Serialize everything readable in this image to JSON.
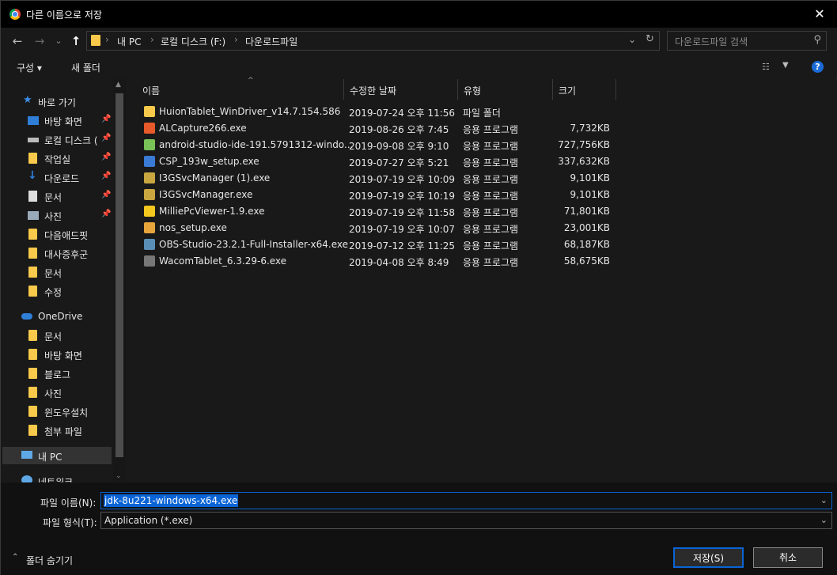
{
  "window": {
    "title": "다른 이름으로 저장",
    "close": "✕"
  },
  "nav": {
    "back": "←",
    "forward": "→",
    "history": "⌄",
    "up": "↑",
    "breadcrumb": [
      "내 PC",
      "로컬 디스크 (F:)",
      "다운로드파일"
    ],
    "search_placeholder": "다운로드파일 검색"
  },
  "toolbar": {
    "organize": "구성 ▾",
    "new_folder": "새 폴더"
  },
  "sidebar": {
    "quick_access": "바로 가기",
    "items": [
      {
        "label": "바탕 화면",
        "icon": "desktop-icon",
        "pinned": true
      },
      {
        "label": "로컬 디스크 (",
        "icon": "drive-icon",
        "pinned": true
      },
      {
        "label": "작업실",
        "icon": "folder-icon",
        "pinned": true
      },
      {
        "label": "다운로드",
        "icon": "download-icon",
        "pinned": true
      },
      {
        "label": "문서",
        "icon": "document-icon",
        "pinned": true
      },
      {
        "label": "사진",
        "icon": "picture-icon",
        "pinned": true
      },
      {
        "label": "다음애드핏",
        "icon": "folder-icon",
        "pinned": false
      },
      {
        "label": "대사증후군",
        "icon": "folder-icon",
        "pinned": false
      },
      {
        "label": "문서",
        "icon": "folder-icon",
        "pinned": false
      },
      {
        "label": "수정",
        "icon": "folder-icon",
        "pinned": false
      }
    ],
    "onedrive": "OneDrive",
    "onedrive_items": [
      "문서",
      "바탕 화면",
      "블로그",
      "사진",
      "윈도우설치",
      "첨부 파일"
    ],
    "this_pc": "내 PC",
    "network": "네트워크"
  },
  "columns": {
    "name": "이름",
    "date": "수정한 날짜",
    "type": "유형",
    "size": "크기"
  },
  "files": [
    {
      "name": "HuionTablet_WinDriver_v14.7.154.586",
      "date": "2019-07-24 오후 11:56",
      "type": "파일 폴더",
      "size": "",
      "icon": "folder-icon",
      "color": "#f8c94a"
    },
    {
      "name": "ALCapture266.exe",
      "date": "2019-08-26 오후 7:45",
      "type": "응용 프로그램",
      "size": "7,732KB",
      "icon": "alcapture-icon",
      "color": "#e85a2a"
    },
    {
      "name": "android-studio-ide-191.5791312-windo...",
      "date": "2019-09-08 오후 9:10",
      "type": "응용 프로그램",
      "size": "727,756KB",
      "icon": "android-icon",
      "color": "#78c257"
    },
    {
      "name": "CSP_193w_setup.exe",
      "date": "2019-07-27 오후 5:21",
      "type": "응용 프로그램",
      "size": "337,632KB",
      "icon": "installer-icon",
      "color": "#3a7bd5"
    },
    {
      "name": "I3GSvcManager (1).exe",
      "date": "2019-07-19 오후 10:09",
      "type": "응용 프로그램",
      "size": "9,101KB",
      "icon": "setup-icon",
      "color": "#c9a640"
    },
    {
      "name": "I3GSvcManager.exe",
      "date": "2019-07-19 오후 10:19",
      "type": "응용 프로그램",
      "size": "9,101KB",
      "icon": "setup-icon",
      "color": "#c9a640"
    },
    {
      "name": "MilliePcViewer-1.9.exe",
      "date": "2019-07-19 오후 11:58",
      "type": "응용 프로그램",
      "size": "71,801KB",
      "icon": "millie-icon",
      "color": "#f4c81e"
    },
    {
      "name": "nos_setup.exe",
      "date": "2019-07-19 오후 10:07",
      "type": "응용 프로그램",
      "size": "23,001KB",
      "icon": "nos-icon",
      "color": "#e7a53c"
    },
    {
      "name": "OBS-Studio-23.2.1-Full-Installer-x64.exe",
      "date": "2019-07-12 오후 11:25",
      "type": "응용 프로그램",
      "size": "68,187KB",
      "icon": "obs-icon",
      "color": "#5a8fb5"
    },
    {
      "name": "WacomTablet_6.3.29-6.exe",
      "date": "2019-04-08 오후 8:49",
      "type": "응용 프로그램",
      "size": "58,675KB",
      "icon": "wacom-icon",
      "color": "#777777"
    }
  ],
  "form": {
    "filename_label": "파일 이름(N):",
    "filename_value": "jdk-8u221-windows-x64.exe",
    "filetype_label": "파일 형식(T):",
    "filetype_value": "Application (*.exe)"
  },
  "buttons": {
    "hide_folders": "폴더 숨기기",
    "save": "저장(S)",
    "cancel": "취소"
  }
}
